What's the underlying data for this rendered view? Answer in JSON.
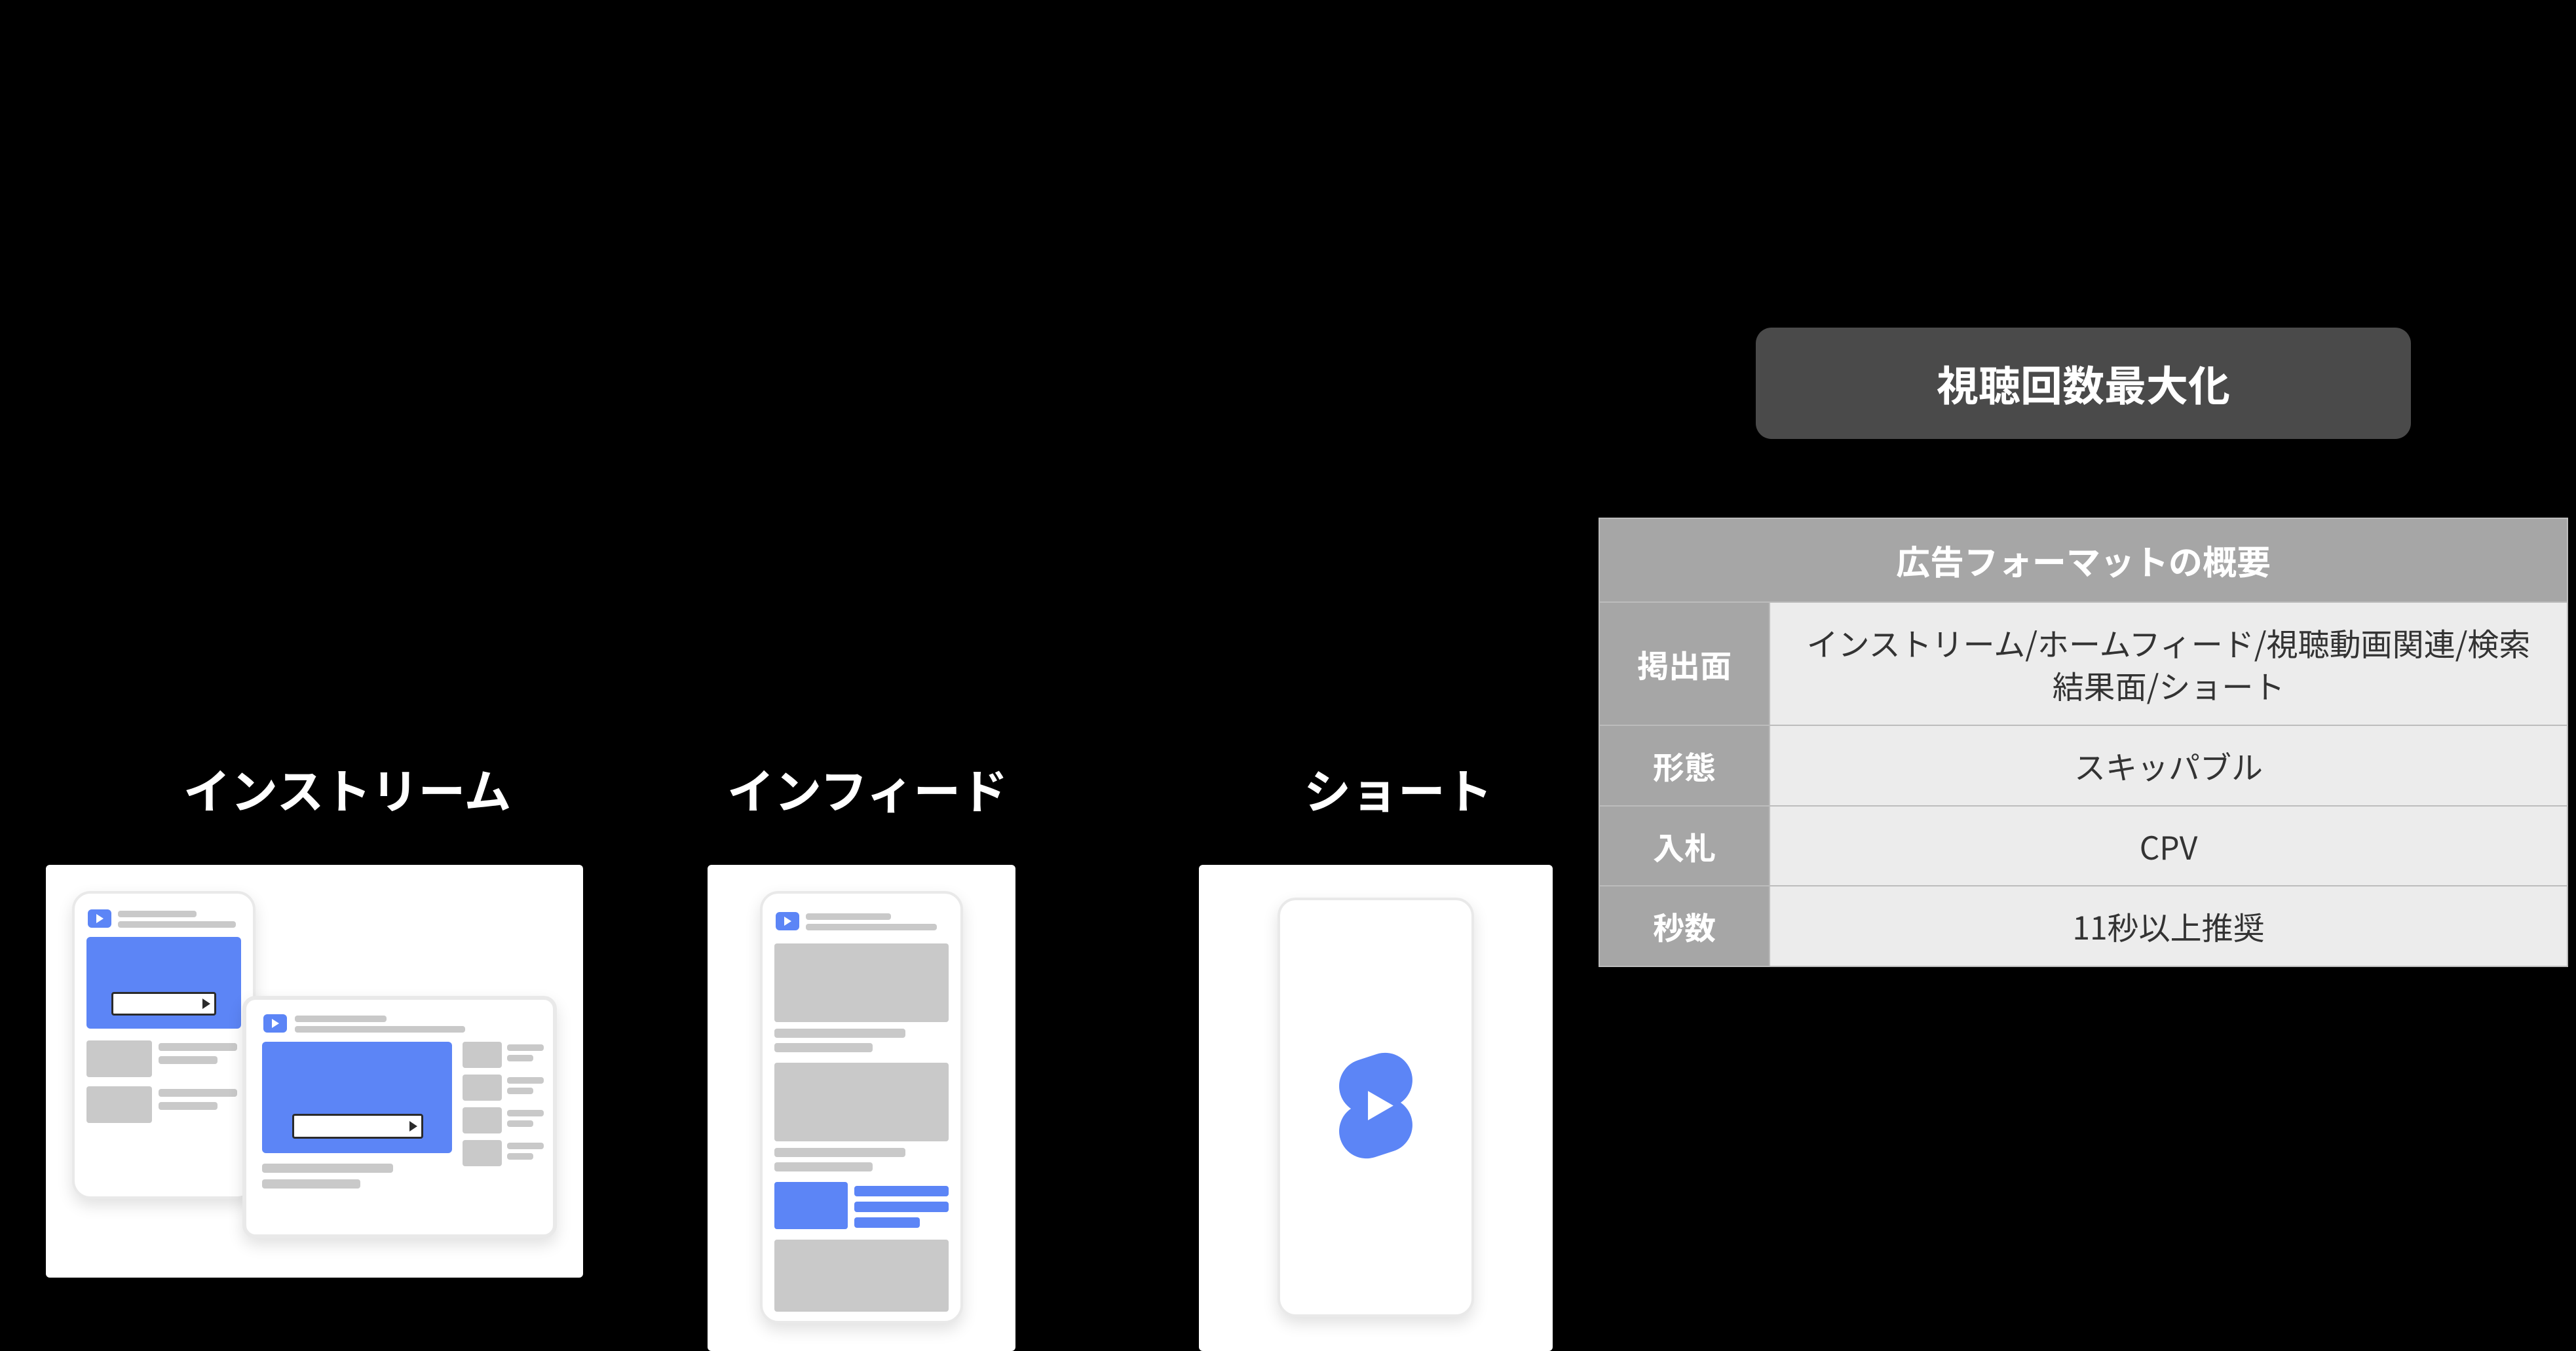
{
  "sections": {
    "instream": "インストリーム",
    "infeed": "インフィード",
    "shorts": "ショート"
  },
  "right": {
    "badge": "視聴回数最大化",
    "table": {
      "header": "広告フォーマットの概要",
      "rows": [
        {
          "label": "掲出面",
          "value": "インストリーム/ホームフィード/視聴動画関連/検索結果面/ショート"
        },
        {
          "label": "形態",
          "value": "スキッパブル"
        },
        {
          "label": "入札",
          "value": "CPV"
        },
        {
          "label": "秒数",
          "value": "11秒以上推奨"
        }
      ]
    }
  },
  "colors": {
    "accent": "#5c85f6",
    "panel_bg": "#ffffff",
    "table_header_bg": "#a6a6a6",
    "table_cell_bg": "#ececec",
    "badge_bg": "#4a4a4a"
  },
  "icons": {
    "play": "play-icon",
    "shorts": "shorts-icon"
  }
}
